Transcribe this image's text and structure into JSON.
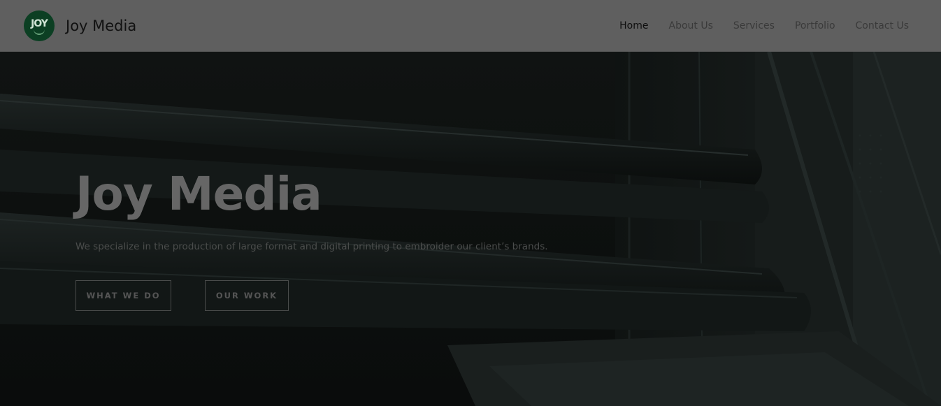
{
  "header": {
    "logo_text": "JOY",
    "brand": "Joy Media",
    "nav": [
      {
        "label": "Home",
        "active": true
      },
      {
        "label": "About Us",
        "active": false
      },
      {
        "label": "Services",
        "active": false
      },
      {
        "label": "Portfolio",
        "active": false
      },
      {
        "label": "Contact Us",
        "active": false
      }
    ]
  },
  "hero": {
    "title": "Joy Media",
    "subtitle": "We specialize in the production of large format and digital printing to embroider our client’s brands.",
    "buttons": {
      "what_we_do": "WHAT WE DO",
      "our_work": "OUR WORK"
    }
  },
  "colors": {
    "header_bg": "#5f5f5f",
    "logo_bg": "#0c3f23",
    "hero_overlay": "#0c0f0e"
  }
}
